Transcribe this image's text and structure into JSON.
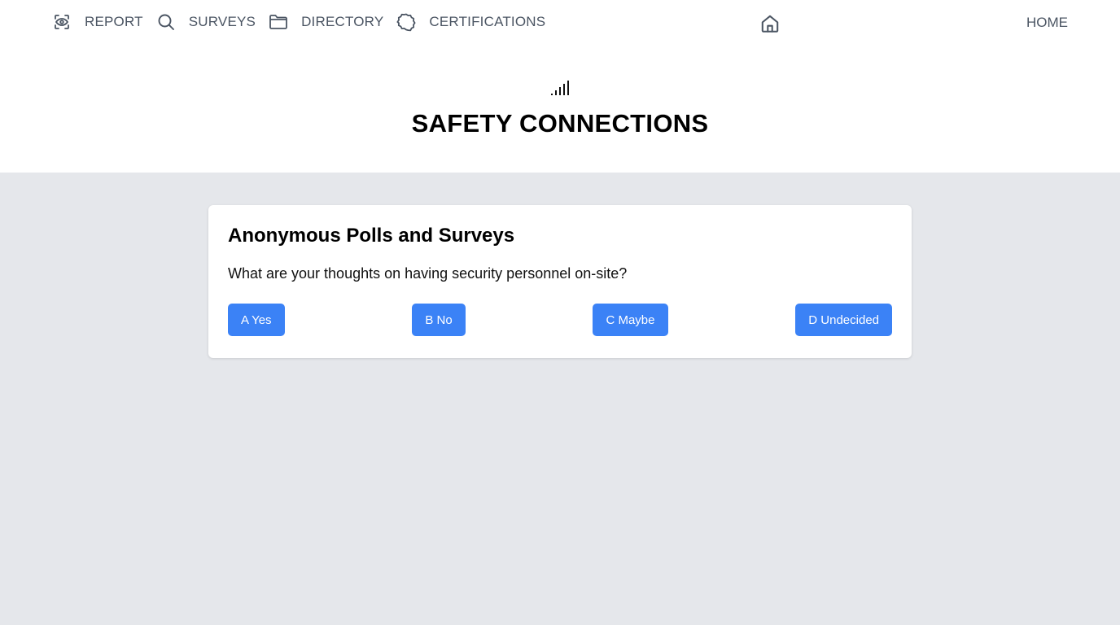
{
  "nav": {
    "items": [
      {
        "label": "REPORT",
        "icon": "eye-icon"
      },
      {
        "label": "SURVEYS",
        "icon": "search-icon"
      },
      {
        "label": "DIRECTORY",
        "icon": "folder-icon"
      },
      {
        "label": "CERTIFICATIONS",
        "icon": "badge-icon"
      }
    ],
    "home_icon": "home-icon",
    "home_label": "HOME"
  },
  "header": {
    "logo_icon": "signal-bars-icon",
    "title": "SAFETY CONNECTIONS"
  },
  "poll": {
    "heading": "Anonymous Polls and Surveys",
    "question": "What are your thoughts on having security personnel on-site?",
    "options": [
      "A Yes",
      "B No",
      "C Maybe",
      "D Undecided"
    ]
  },
  "colors": {
    "accent": "#3b82f6",
    "background": "#e5e7eb",
    "nav_text": "#4b5563"
  }
}
